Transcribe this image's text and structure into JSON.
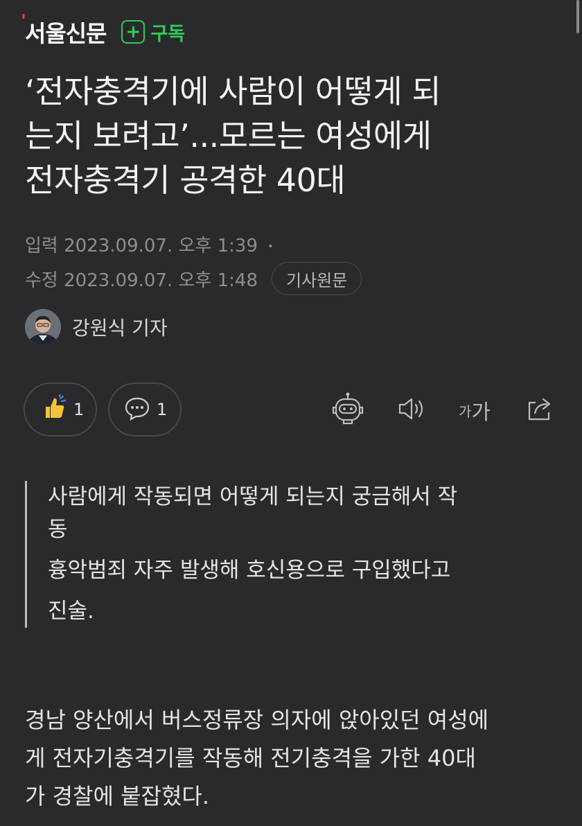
{
  "header": {
    "logo_text": "서울신문",
    "logo_tick": "'",
    "subscribe_plus": "+",
    "subscribe_label": "구독"
  },
  "article": {
    "title_lines": [
      "‘전자충격기에 사람이 어떻게 되",
      "는지 보려고’...모르는 여성에게",
      "전자충격기 공격한 40대"
    ],
    "input_time": "입력 2023.09.07. 오후 1:39",
    "dot": "•",
    "edit_time": "수정 2023.09.07. 오후 1:48",
    "original_button": "기사원문",
    "reporter_name": "강원식 기자",
    "summary_lines": [
      "사람에게 작동되면 어떻게 되는지 궁금해서 작",
      "동",
      "흉악범죄 자주 발생해 호신용으로 구입했다고",
      "진술."
    ],
    "body_lines": [
      "경남 양산에서 버스정류장 의자에 앉아있던 여성에",
      "게 전자기충격기를 작동해 전기충격을 가한 40대",
      "가 경찰에 붙잡혔다."
    ]
  },
  "actions": {
    "like_count": "1",
    "comment_count": "1",
    "font_small": "가",
    "font_large": "가"
  },
  "colors": {
    "background": "#2a2a2d",
    "accent_green": "#2ecc5c",
    "logo_tick": "#e8412f",
    "like_yellow": "#f5c33b"
  },
  "icons": [
    "thumbs-up-icon",
    "comment-icon",
    "robot-icon",
    "speaker-icon",
    "share-icon"
  ]
}
